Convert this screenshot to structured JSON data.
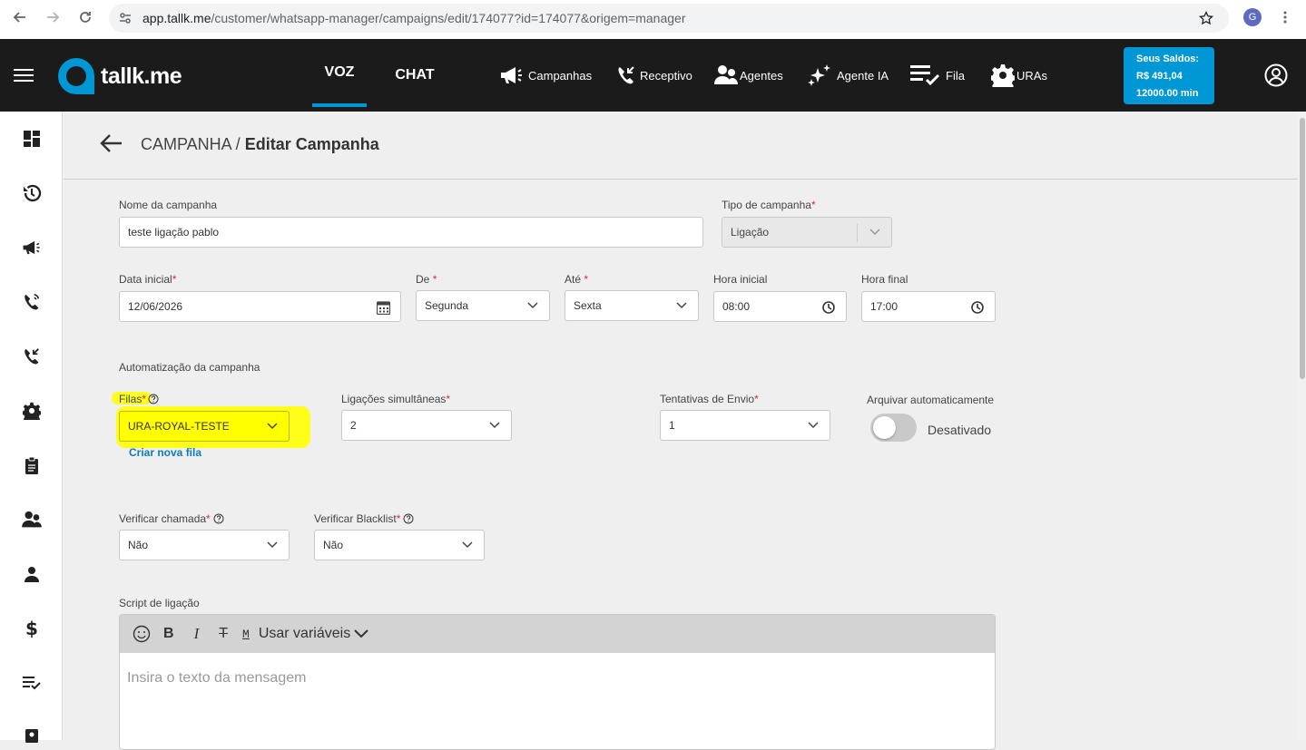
{
  "browser": {
    "url_host": "app.tallk.me",
    "url_path": "/customer/whatsapp-manager/campaigns/edit/174077?id=174077&origem=manager",
    "profile_initial": "G"
  },
  "appbar": {
    "logo_text": "tallk.me",
    "tabs": [
      {
        "label": "VOZ",
        "active": true
      },
      {
        "label": "CHAT",
        "active": false
      }
    ],
    "nav": [
      {
        "label": "Campanhas",
        "icon": "megaphone-icon"
      },
      {
        "label": "Receptivo",
        "icon": "phone-incoming-icon"
      },
      {
        "label": "Agentes",
        "icon": "agents-icon"
      },
      {
        "label": "Agente IA",
        "icon": "sparkles-icon"
      },
      {
        "label": "Fila",
        "icon": "queue-list-icon"
      },
      {
        "label": "URAs",
        "icon": "gear-icon"
      }
    ],
    "balance": {
      "title": "Seus Saldos:",
      "money": "R$ 491,04",
      "minutes": "12000.00 min"
    },
    "accent": "#0097d7"
  },
  "breadcrumb": {
    "parent": "CAMPANHA /",
    "current": "Editar Campanha"
  },
  "form": {
    "campaign_name": {
      "label": "Nome da campanha",
      "value": "teste ligação pablo"
    },
    "campaign_type": {
      "label": "Tipo de campanha",
      "value": "Ligação"
    },
    "start_date": {
      "label": "Data inicial",
      "value": "12/06/2026"
    },
    "from_day": {
      "label": "De",
      "value": "Segunda"
    },
    "to_day": {
      "label": "Até",
      "value": "Sexta"
    },
    "start_hour": {
      "label": "Hora inicial",
      "value": "08:00"
    },
    "end_hour": {
      "label": "Hora final",
      "value": "17:00"
    },
    "automation_title": "Automatização da campanha",
    "queues": {
      "label": "Filas",
      "value": "URA-ROYAL-TESTE",
      "link": "Criar nova fila"
    },
    "simultaneous": {
      "label": "Ligações simultâneas",
      "value": "2"
    },
    "attempts": {
      "label": "Tentativas de Envio",
      "value": "1"
    },
    "auto_archive": {
      "label": "Arquivar automaticamente",
      "state": "Desativado"
    },
    "verify_call": {
      "label": "Verificar chamada",
      "value": "Não"
    },
    "verify_blacklist": {
      "label": "Verificar Blacklist",
      "value": "Não"
    },
    "script": {
      "label": "Script de ligação",
      "variables": "Usar variáveis",
      "placeholder": "Insira o texto da mensagem"
    }
  },
  "highlight_color": "#ffff00"
}
